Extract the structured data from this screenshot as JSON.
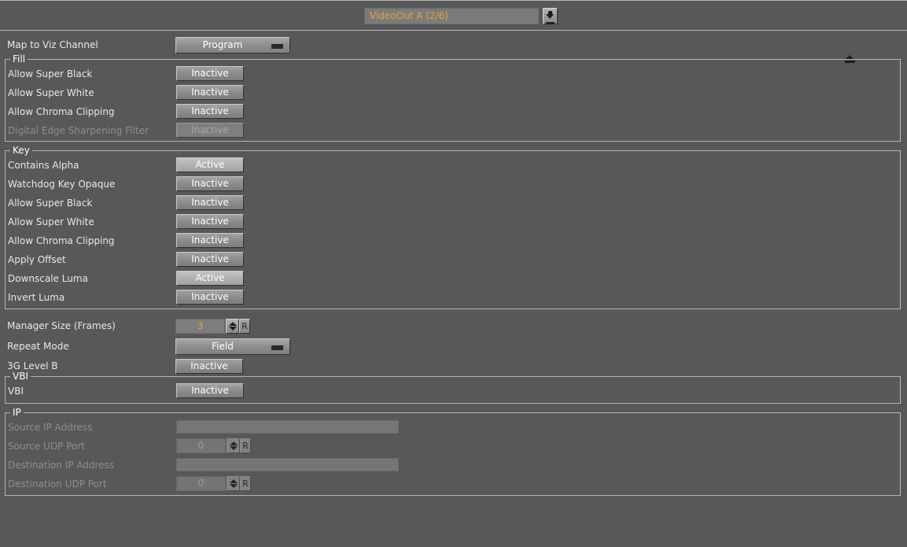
{
  "header": {
    "channel_value": "VideoOut A (2/6)",
    "load_button_icon": "download-icon"
  },
  "top": {
    "map_label": "Map to Viz Channel",
    "map_value": "Program",
    "eject_icon": "eject-icon"
  },
  "groups": {
    "fill": {
      "title": "Fill",
      "rows": [
        {
          "label": "Allow Super Black",
          "value": "Inactive",
          "state": "inactive",
          "disabled": false
        },
        {
          "label": "Allow Super White",
          "value": "Inactive",
          "state": "inactive",
          "disabled": false
        },
        {
          "label": "Allow Chroma Clipping",
          "value": "Inactive",
          "state": "inactive",
          "disabled": false
        },
        {
          "label": "Digital Edge Sharpening Filter",
          "value": "Inactive",
          "state": "inactive",
          "disabled": true
        }
      ]
    },
    "key": {
      "title": "Key",
      "rows": [
        {
          "label": "Contains Alpha",
          "value": "Active",
          "state": "active",
          "disabled": false
        },
        {
          "label": "Watchdog Key Opaque",
          "value": "Inactive",
          "state": "inactive",
          "disabled": false
        },
        {
          "label": "Allow Super Black",
          "value": "Inactive",
          "state": "inactive",
          "disabled": false
        },
        {
          "label": "Allow Super White",
          "value": "Inactive",
          "state": "inactive",
          "disabled": false
        },
        {
          "label": "Allow Chroma Clipping",
          "value": "Inactive",
          "state": "inactive",
          "disabled": false
        },
        {
          "label": "Apply Offset",
          "value": "Inactive",
          "state": "inactive",
          "disabled": false
        },
        {
          "label": "Downscale Luma",
          "value": "Active",
          "state": "active",
          "disabled": false
        },
        {
          "label": "Invert Luma",
          "value": "Inactive",
          "state": "inactive",
          "disabled": false
        }
      ]
    },
    "vbi": {
      "title": "VBI",
      "rows": [
        {
          "label": "VBI",
          "value": "Inactive",
          "state": "inactive",
          "disabled": false
        }
      ]
    },
    "ip": {
      "title": "IP",
      "rows": [
        {
          "label": "Source IP Address",
          "kind": "text",
          "value": "",
          "disabled": true
        },
        {
          "label": "Source UDP Port",
          "kind": "spinner",
          "value": "0",
          "disabled": true
        },
        {
          "label": "Destination IP Address",
          "kind": "text",
          "value": "",
          "disabled": true
        },
        {
          "label": "Destination UDP Port",
          "kind": "spinner",
          "value": "0",
          "disabled": true
        }
      ]
    }
  },
  "middle": {
    "manager_size_label": "Manager Size (Frames)",
    "manager_size_value": "3",
    "repeat_mode_label": "Repeat Mode",
    "repeat_mode_value": "Field",
    "level_b_label": "3G Level B",
    "level_b_value": "Inactive",
    "reset_button_label": "R"
  },
  "colors": {
    "background": "#585858",
    "accent_text": "#e8a33d",
    "label_text": "#e8e8e8",
    "disabled_text": "#8e8e8e",
    "border": "#b4b4b4"
  }
}
